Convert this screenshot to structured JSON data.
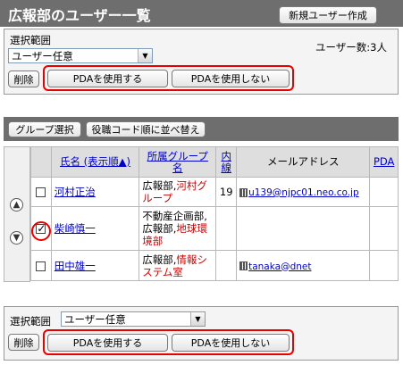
{
  "header": {
    "title": "広報部のユーザー一覧",
    "new_user_button": "新規ユーザー作成"
  },
  "top": {
    "scope_label": "選択範囲",
    "scope_value": "ユーザー任意",
    "user_count": "ユーザー数:3人",
    "delete_button": "削除",
    "use_pda_button": "PDAを使用する",
    "no_pda_button": "PDAを使用しない"
  },
  "group_bar": {
    "group_select_button": "グループ選択",
    "sort_button": "役職コード順に並べ替え"
  },
  "table": {
    "headers": [
      "氏名 (表示順▲)",
      "所属グループ名",
      "内線",
      "メールアドレス",
      "PDA"
    ],
    "rows": [
      {
        "name": "河村正治",
        "group_black": "広報部,",
        "group_red": "河村グループ",
        "ext": "19",
        "email": "u139@njpc01.neo.co.jp",
        "checked": false
      },
      {
        "name": "柴崎慎一",
        "group_black": "不動産企画部,広報部,",
        "group_red": "地球環境部",
        "ext": "",
        "email": "",
        "checked": true
      },
      {
        "name": "田中雄一",
        "group_black": "広報部,",
        "group_red": "情報システム室",
        "ext": "",
        "email": "tanaka@dnet",
        "checked": false
      }
    ]
  },
  "bottom": {
    "scope_label": "選択範囲",
    "scope_value": "ユーザー任意",
    "delete_button": "削除",
    "use_pda_button": "PDAを使用する",
    "no_pda_button": "PDAを使用しない"
  },
  "icons": {
    "up": "up-arrow-icon",
    "down": "down-arrow-icon",
    "building": "building-icon"
  },
  "colors": {
    "header_bg": "#6e6e6e",
    "highlight": "#e80000",
    "link": "#0000cc"
  }
}
